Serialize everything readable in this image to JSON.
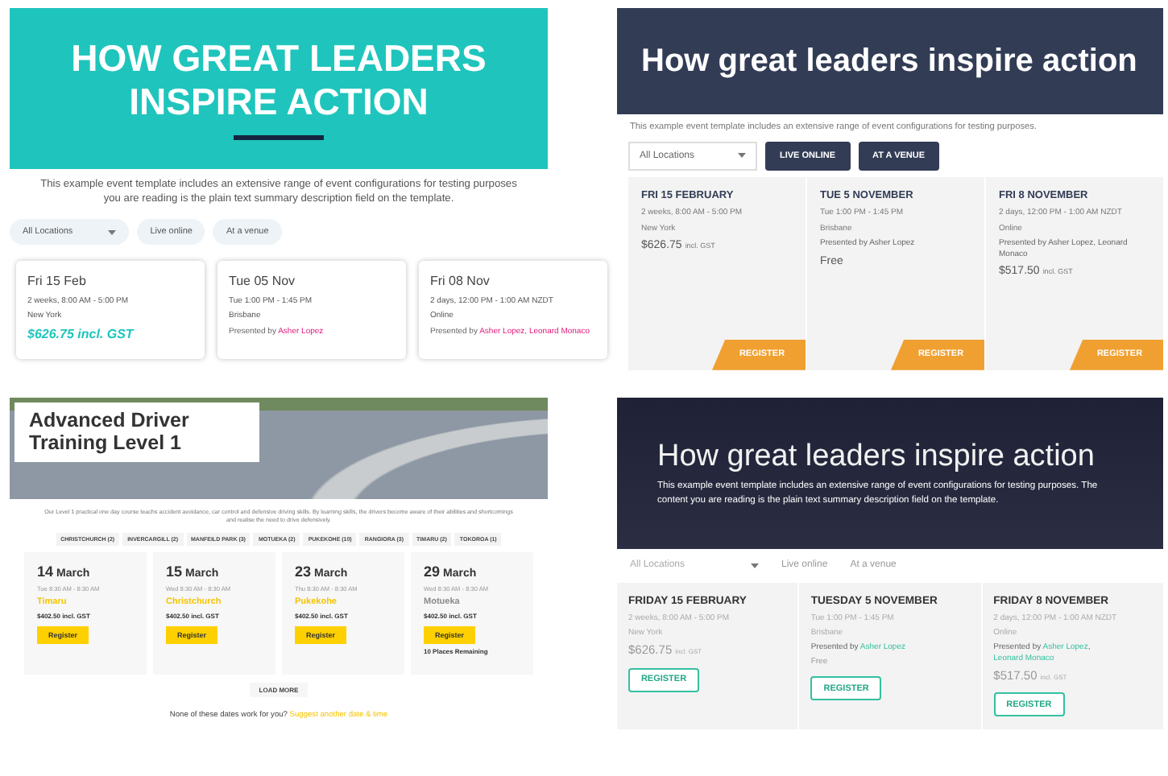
{
  "panels": [
    {
      "kind": "teal",
      "title": "HOW GREAT LEADERS INSPIRE ACTION",
      "description_lines": [
        "This example event template includes an extensive range of event configurations for testing purposes",
        "you are reading is the plain text summary description field on the template."
      ],
      "location_filter": "All Locations",
      "filter_buttons": [
        "Live online",
        "At a venue"
      ],
      "events": [
        {
          "date": "Fri 15 Feb",
          "time": "2 weeks, 8:00 AM - 5:00 PM",
          "location": "New York",
          "price": "$626.75 incl. GST"
        },
        {
          "date": "Tue 05 Nov",
          "time": "Tue 1:00 PM - 1:45 PM",
          "location": "Brisbane",
          "presenter_label": "Presented by",
          "presenters": [
            "Asher Lopez"
          ]
        },
        {
          "date": "Fri 08 Nov",
          "time": "2 days, 12:00 PM - 1:00 AM NZDT",
          "location": "Online",
          "presenter_label": "Presented by",
          "presenters": [
            "Asher Lopez",
            "Leonard Monaco"
          ],
          "presenter_separator": ","
        }
      ]
    },
    {
      "kind": "navy",
      "title": "How great leaders inspire action",
      "description_lines": [
        "This example event template includes an extensive range of event configurations for testing purposes."
      ],
      "location_filter": "All Locations",
      "filter_buttons": [
        "LIVE ONLINE",
        "AT A VENUE"
      ],
      "events": [
        {
          "date": "FRI 15 FEBRUARY",
          "time": "2 weeks, 8:00 AM - 5:00 PM",
          "location": "New York",
          "price": "$626.75",
          "price_note": "incl. GST",
          "button": "REGISTER"
        },
        {
          "date": "TUE 5 NOVEMBER",
          "time": "Tue 1:00 PM - 1:45 PM",
          "location": "Brisbane",
          "presenter_label": "Presented by",
          "presenters": [
            "Asher Lopez"
          ],
          "price": "Free",
          "button": "REGISTER"
        },
        {
          "date": "FRI 8 NOVEMBER",
          "time": "2 days, 12:00 PM - 1:00 AM NZDT",
          "location": "Online",
          "presenter_label": "Presented by",
          "presenters": [
            "Asher Lopez",
            "Leonard Monaco"
          ],
          "presenter_separator": ",",
          "price": "$517.50",
          "price_note": "incl. GST",
          "button": "REGISTER"
        }
      ]
    },
    {
      "kind": "photo",
      "title": "Advanced Driver Training Level 1",
      "description_lines": [
        "Our Level 1 practical one day course teachs accident avoidance, car control and defensive driving skills. By learning skills, the drivers become aware of their abilities and shortcomings and realise the need to drive defensively."
      ],
      "location_chips": [
        "CHRISTCHURCH (2)",
        "INVERCARGILL (2)",
        "MANFEILD PARK (3)",
        "MOTUEKA (2)",
        "PUKEKOHE (10)",
        "RANGIORA (3)",
        "TIMARU (2)",
        "TOKOROA (1)"
      ],
      "events": [
        {
          "day": "14",
          "month": "March",
          "time": "Tue 8:30 AM - 8:30 AM",
          "location": "Timaru",
          "color": "#f5c400",
          "price": "$402.50 incl. GST",
          "button": "Register"
        },
        {
          "day": "15",
          "month": "March",
          "time": "Wed 8:30 AM - 8:30 AM",
          "location": "Christchurch",
          "color": "#f5c400",
          "price": "$402.50 incl. GST",
          "button": "Register"
        },
        {
          "day": "23",
          "month": "March",
          "time": "Thu 8:30 AM - 8:30 AM",
          "location": "Pukekohe",
          "color": "#f5c400",
          "price": "$402.50 incl. GST",
          "button": "Register"
        },
        {
          "day": "29",
          "month": "March",
          "time": "Wed 8:30 AM - 8:30 AM",
          "location": "Motueka",
          "color": "#8a8a8a",
          "price": "$402.50 incl. GST",
          "button": "Register",
          "remaining": "10 Places Remaining"
        }
      ],
      "load_more": "LOAD MORE",
      "footer_text": "None of these dates work for you?",
      "footer_link": "Suggest another date & time"
    },
    {
      "kind": "dark",
      "title": "How great leaders inspire action",
      "description_lines": [
        "This example event template includes an extensive range of event configurations for testing purposes. The content you are reading is the plain text summary description field on the template."
      ],
      "location_filter": "All Locations",
      "filter_buttons": [
        "Live online",
        "At a venue"
      ],
      "events": [
        {
          "date": "FRIDAY 15 FEBRUARY",
          "time": "2 weeks, 8:00 AM - 5:00 PM",
          "location": "New York",
          "price": "$626.75",
          "price_note": "incl. GST",
          "button": "REGISTER"
        },
        {
          "date": "TUESDAY 5 NOVEMBER",
          "time": "Tue 1:00 PM - 1:45 PM",
          "location": "Brisbane",
          "presenter_label": "Presented by",
          "presenters": [
            "Asher Lopez"
          ],
          "price": "Free",
          "button": "REGISTER"
        },
        {
          "date": "FRIDAY 8 NOVEMBER",
          "time": "2 days, 12:00 PM - 1:00 AM NZDT",
          "location": "Online",
          "presenter_label": "Presented by",
          "presenters": [
            "Asher Lopez",
            "Leonard Monaco"
          ],
          "presenter_separator": ",",
          "price": "$517.50",
          "price_note": "incl. GST",
          "button": "REGISTER"
        }
      ]
    }
  ]
}
